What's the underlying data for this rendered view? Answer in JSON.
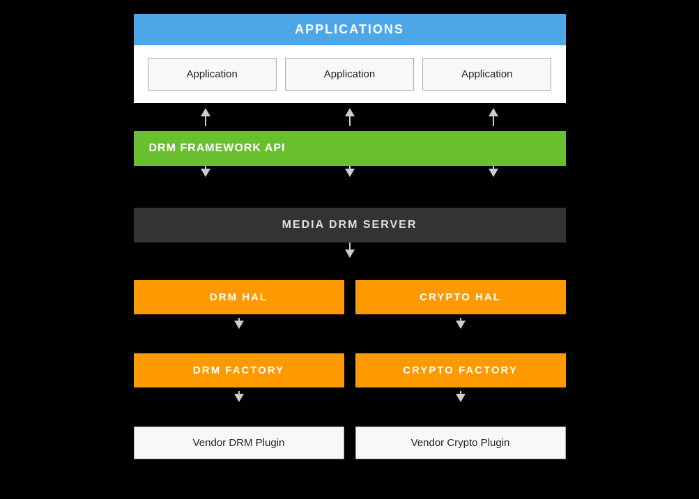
{
  "applications": {
    "header": "APPLICATIONS",
    "apps": [
      {
        "label": "Application"
      },
      {
        "label": "Application"
      },
      {
        "label": "Application"
      }
    ]
  },
  "drm_framework": {
    "label": "DRM FRAMEWORK API"
  },
  "media_drm_server": {
    "label": "MEDIA DRM SERVER"
  },
  "hal_row": [
    {
      "label": "DRM HAL"
    },
    {
      "label": "CRYPTO HAL"
    }
  ],
  "factory_row": [
    {
      "label": "DRM FACTORY"
    },
    {
      "label": "CRYPTO FACTORY"
    }
  ],
  "vendor_row": [
    {
      "label": "Vendor DRM Plugin"
    },
    {
      "label": "Vendor Crypto Plugin"
    }
  ],
  "colors": {
    "app_blue": "#4da6e8",
    "drm_green": "#6abf2e",
    "media_dark": "#333333",
    "hal_orange": "#ff9900",
    "vendor_white": "#f8f8f8",
    "arrow_color": "#cccccc",
    "background": "#000000"
  }
}
